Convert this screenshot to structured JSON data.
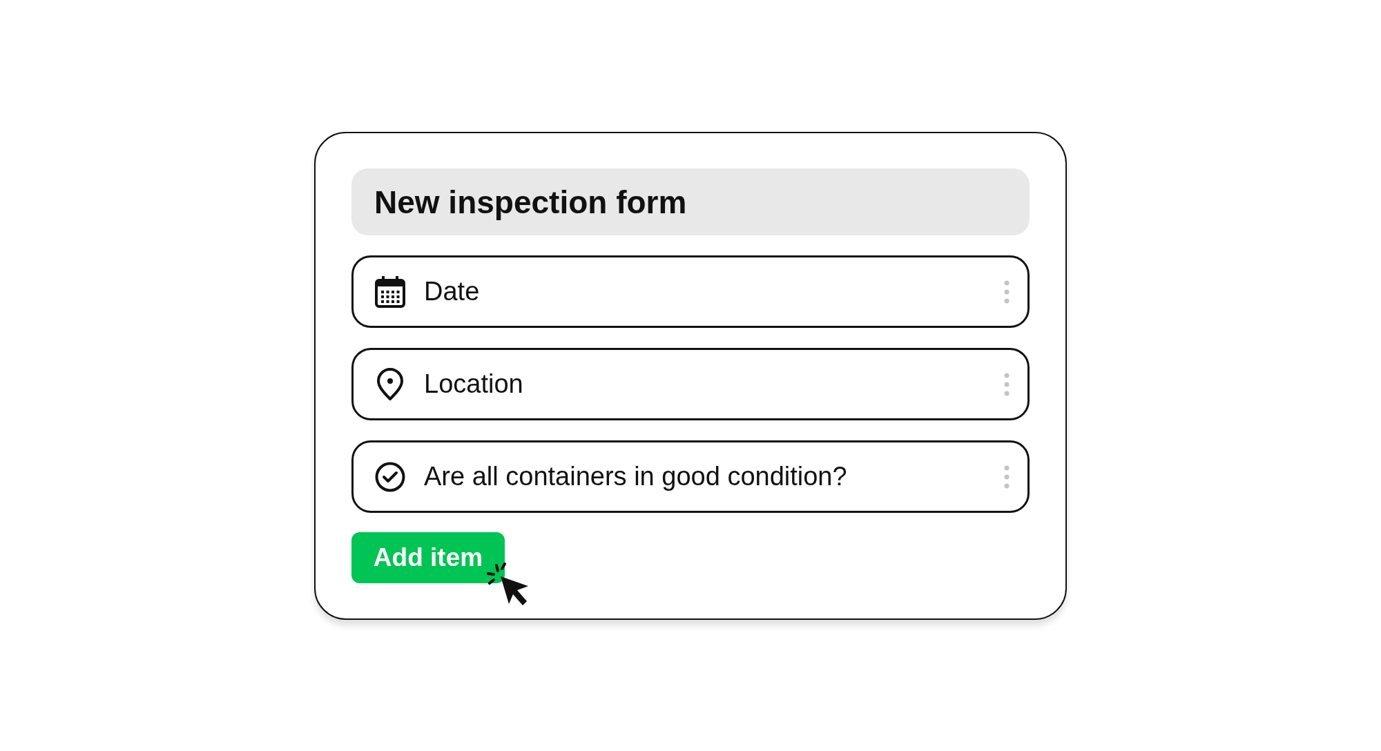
{
  "form": {
    "title": "New inspection form",
    "items": [
      {
        "kind": "date",
        "label": "Date"
      },
      {
        "kind": "location",
        "label": "Location"
      },
      {
        "kind": "check",
        "label": "Are all containers in good condition?"
      }
    ],
    "button": "Add item"
  }
}
